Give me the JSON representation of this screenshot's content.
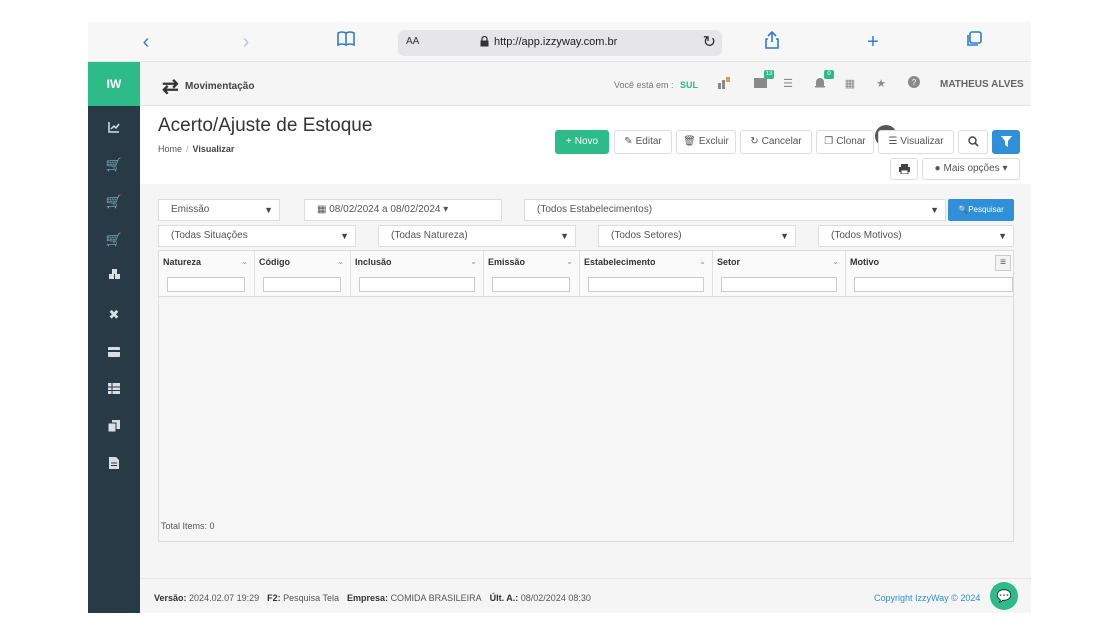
{
  "browser": {
    "url": "http://app.izzyway.com.br",
    "text_size_label": "AA"
  },
  "sidebar": {
    "logo": "IW"
  },
  "header": {
    "title": "Movimentação",
    "location_label": "Você está em :",
    "location_value": "SUL",
    "badge_1": "13",
    "badge_2": "0",
    "user": "MATHEUS ALVES"
  },
  "page": {
    "title": "Acerto/Ajuste de Estoque",
    "breadcrumb_home": "Home",
    "breadcrumb_current": "Visualizar"
  },
  "toolbar": {
    "novo": "Novo",
    "editar": "Editar",
    "excluir": "Excluir",
    "cancelar": "Cancelar",
    "clonar": "Clonar",
    "visualizar": "Visualizar",
    "mais_opcoes": "Mais opções"
  },
  "filters": {
    "emissao": "Emissão",
    "date_range": "08/02/2024 a 08/02/2024",
    "estabelecimentos": "(Todos Estabelecimentos)",
    "pesquisar": "Pesquisar",
    "situacoes": "(Todas Situações",
    "natureza": "(Todas Natureza)",
    "setores": "(Todos Setores)",
    "motivos": "(Todos Motivos)"
  },
  "grid": {
    "columns": [
      "Natureza",
      "Código",
      "Inclusão",
      "Emissão",
      "Estabelecimento",
      "Setor",
      "Motivo"
    ],
    "total_items": "Total Items: 0"
  },
  "footer": {
    "versao_label": "Versão:",
    "versao_value": "2024.02.07 19:29",
    "f2_label": "F2:",
    "f2_value": "Pesquisa Tela",
    "empresa_label": "Empresa:",
    "empresa_value": "COMIDA BRASILEIRA",
    "ult_label": "Últ. A.:",
    "ult_value": "08/02/2024 08:30",
    "copyright": "Copyright IzzyWay © 2024"
  },
  "colors": {
    "accent_green": "#2dbb8a",
    "accent_blue": "#2f8fd8",
    "sidebar_bg": "#293a47"
  }
}
